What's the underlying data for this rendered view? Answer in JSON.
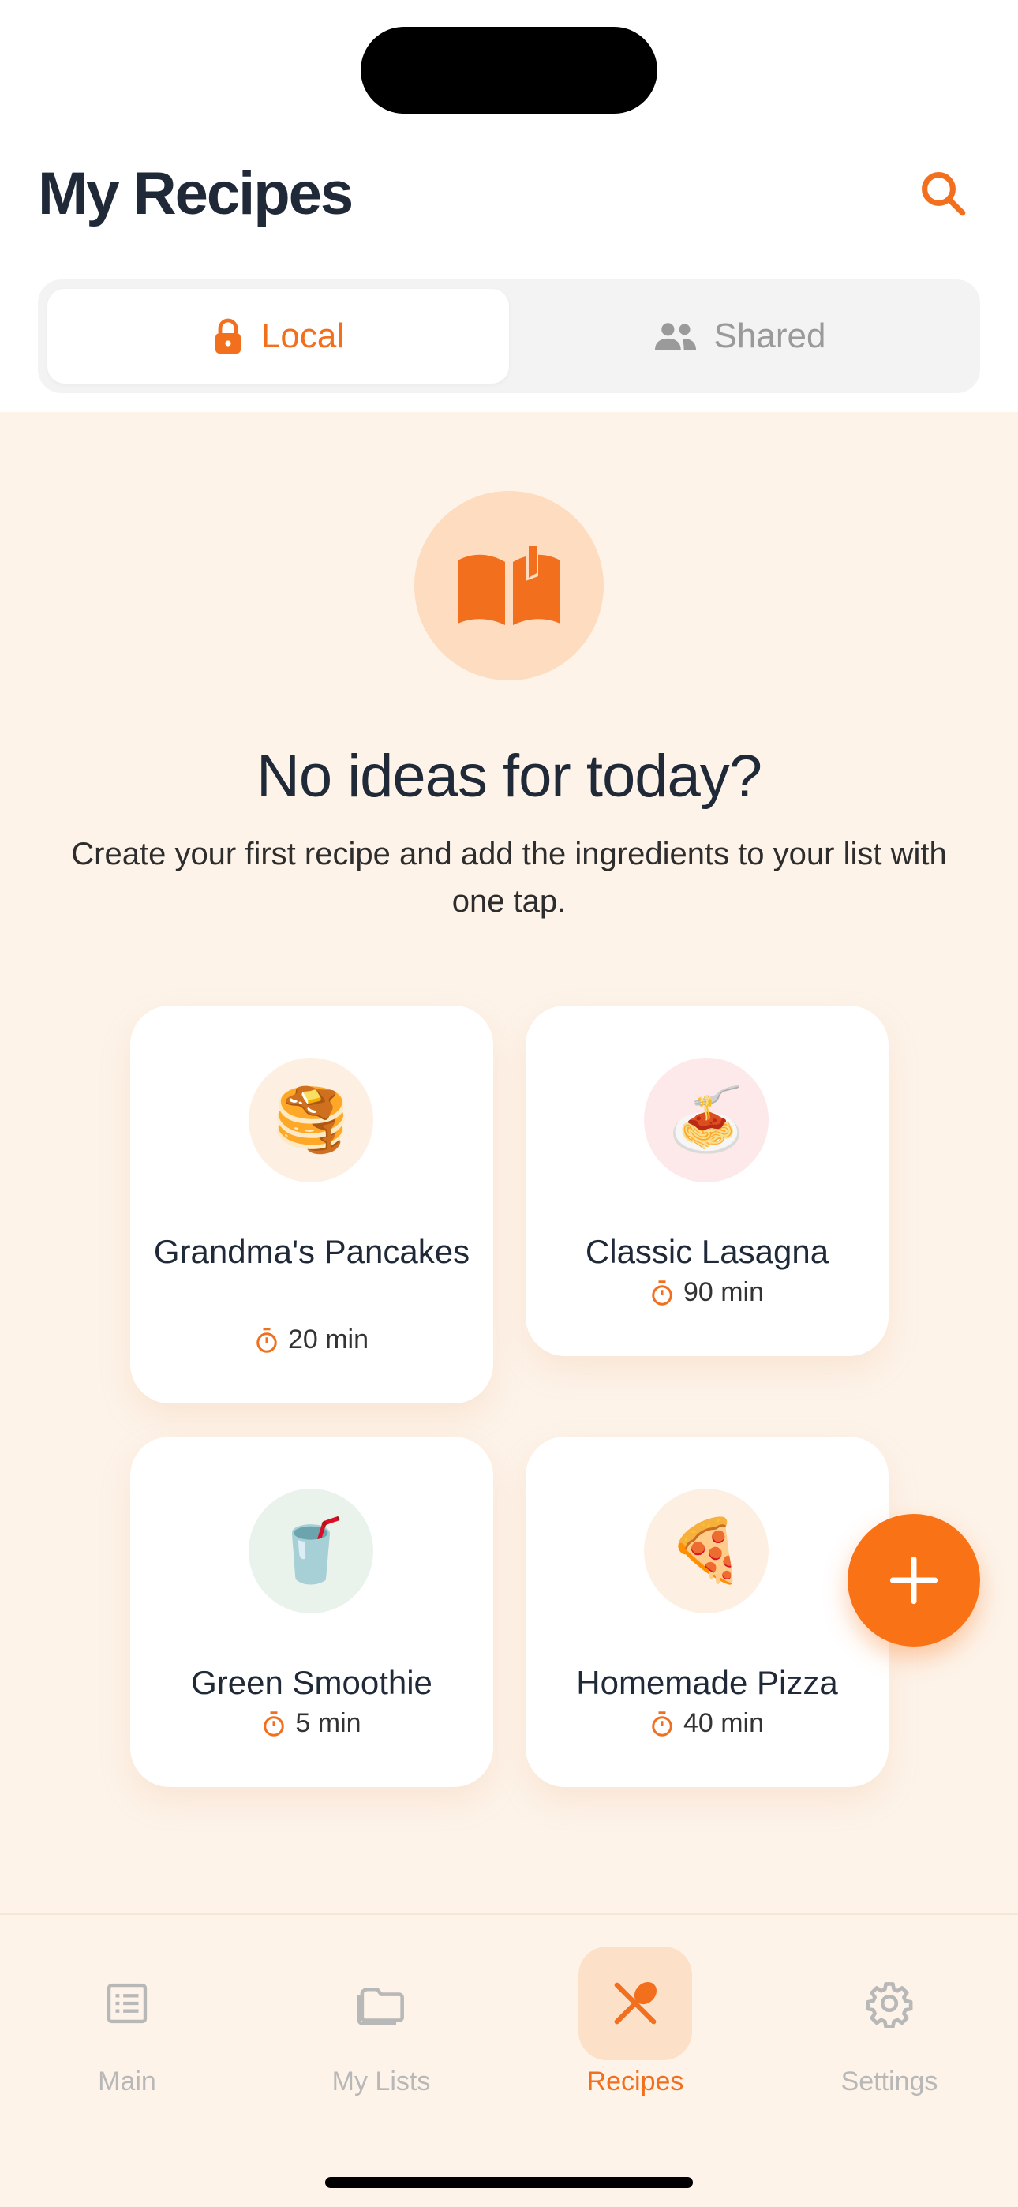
{
  "header": {
    "title": "My Recipes",
    "search_icon": "search-icon"
  },
  "segmented": {
    "local_label": "Local",
    "shared_label": "Shared",
    "selected": "Local"
  },
  "empty_state": {
    "icon": "open-book-icon",
    "title": "No ideas for today?",
    "subtitle": "Create your first recipe and add the ingredients to your list with one tap."
  },
  "recipes": [
    {
      "name": "Grandma's Pancakes",
      "time": "20 min",
      "emoji": "🥞",
      "bg": "#fdf0e3"
    },
    {
      "name": "Classic Lasagna",
      "time": "90 min",
      "emoji": "🍝",
      "bg": "#fde8ea"
    },
    {
      "name": "Green Smoothie",
      "time": "5 min",
      "emoji": "🥤",
      "bg": "#eaf2ec"
    },
    {
      "name": "Homemade Pizza",
      "time": "40 min",
      "emoji": "🍕",
      "bg": "#fdf0e3"
    }
  ],
  "fab": {
    "icon": "plus-icon"
  },
  "tabbar": {
    "items": [
      {
        "label": "Main",
        "icon": "list-icon",
        "active": false
      },
      {
        "label": "My Lists",
        "icon": "folder-icon",
        "active": false
      },
      {
        "label": "Recipes",
        "icon": "utensils-icon",
        "active": true
      },
      {
        "label": "Settings",
        "icon": "gear-icon",
        "active": false
      }
    ]
  },
  "colors": {
    "accent": "#f97316",
    "content_bg": "#fdf3e9",
    "text": "#1f2937"
  }
}
